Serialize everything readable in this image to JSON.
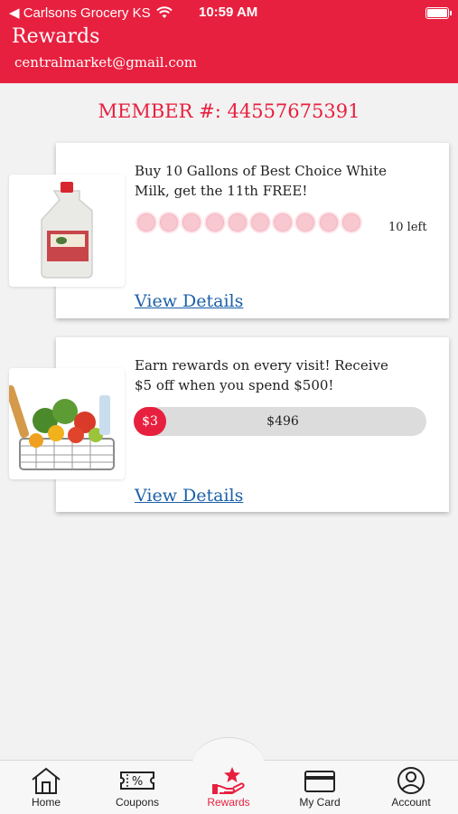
{
  "status_bar": {
    "carrier": "◀ Carlsons Grocery KS",
    "time": "10:59 AM",
    "icons": [
      "wifi-icon",
      "battery-icon"
    ]
  },
  "header": {
    "title": "Rewards",
    "email": "centralmarket@gmail.com"
  },
  "member": {
    "label": "MEMBER #:",
    "number": "44557675391"
  },
  "rewards": [
    {
      "image": "milk-gallon-image",
      "description": "Buy 10 Gallons of Best Choice White Milk, get the 11th FREE!",
      "stamps_total": 10,
      "stamps_filled": 0,
      "remaining": "10 left",
      "link": "View Details"
    },
    {
      "image": "grocery-basket-image",
      "description": "Earn rewards on every visit! Receive $5 off when you spend $500!",
      "earned": "$3",
      "remaining": "$496",
      "progress_fraction": 0.01,
      "link": "View Details"
    }
  ],
  "tabs": [
    {
      "label": "Home",
      "icon": "home-icon"
    },
    {
      "label": "Coupons",
      "icon": "coupon-icon"
    },
    {
      "label": "Rewards",
      "icon": "rewards-hand-star-icon",
      "active": true
    },
    {
      "label": "My Card",
      "icon": "card-icon"
    },
    {
      "label": "Account",
      "icon": "account-icon"
    }
  ],
  "colors": {
    "brand": "#e8203f",
    "link": "#1a5fa8",
    "stamp": "#f8c8d0",
    "background": "#f2f2f2"
  }
}
